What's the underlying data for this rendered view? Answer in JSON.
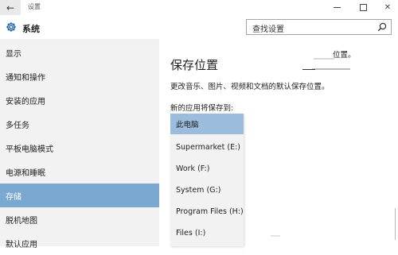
{
  "window": {
    "title": "设置",
    "back_glyph": "←",
    "close_glyph": "✕"
  },
  "header": {
    "title": "系统",
    "icon": "gear-icon",
    "search_placeholder": "查找设置",
    "search_icon": "search-icon"
  },
  "sidebar": {
    "items": [
      {
        "label": "显示"
      },
      {
        "label": "通知和操作"
      },
      {
        "label": "安装的应用"
      },
      {
        "label": "多任务"
      },
      {
        "label": "平板电脑模式"
      },
      {
        "label": "电源和睡眠"
      },
      {
        "label": "存储"
      },
      {
        "label": "脱机地图"
      },
      {
        "label": "默认应用"
      }
    ],
    "selected_index": 6
  },
  "main": {
    "title": "保存位置",
    "description": "更改音乐、图片、视频和文档的默认保存位置。",
    "sub_label": "新的应用将保存到:",
    "faded_text": "位置。",
    "dropdown": {
      "options": [
        {
          "label": "此电脑"
        },
        {
          "label": "Supermarket (E:)"
        },
        {
          "label": "Work (F:)"
        },
        {
          "label": "System (G:)"
        },
        {
          "label": "Program Files (H:)"
        },
        {
          "label": "Files (I:)"
        }
      ],
      "selected_index": 0
    }
  },
  "colors": {
    "sidebar_bg": "#f2f2f2",
    "sidebar_selected": "#7aa8d1",
    "dropdown_selected": "#9bbcdc"
  }
}
